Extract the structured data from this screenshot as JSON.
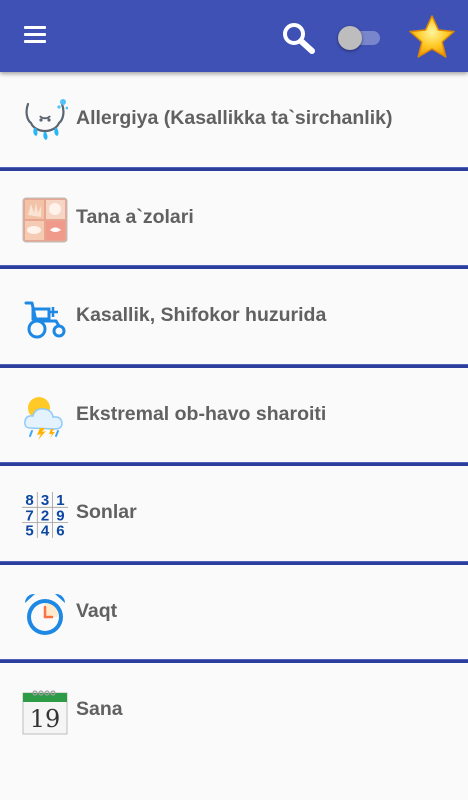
{
  "appbar": {
    "menu_icon": "hamburger-menu-icon",
    "search_icon": "search-icon",
    "toggle_state": "off",
    "favorite_icon": "star-icon",
    "color": "#3f51b5"
  },
  "categories": [
    {
      "label": "Allergiya (Kasallikka ta`sirchanlik)",
      "icon": "allergy-sneeze-icon"
    },
    {
      "label": "Tana a`zolari",
      "icon": "body-parts-icon"
    },
    {
      "label": "Kasallik, Shifokor huzurida",
      "icon": "wheelchair-icon"
    },
    {
      "label": "Ekstremal ob-havo sharoiti",
      "icon": "storm-weather-icon"
    },
    {
      "label": "Sonlar",
      "icon": "numbers-grid-icon",
      "digits": [
        "8",
        "3",
        "1",
        "7",
        "2",
        "9",
        "5",
        "4",
        "6"
      ]
    },
    {
      "label": "Vaqt",
      "icon": "alarm-clock-icon"
    },
    {
      "label": "Sana",
      "icon": "calendar-icon",
      "day": "19"
    }
  ]
}
